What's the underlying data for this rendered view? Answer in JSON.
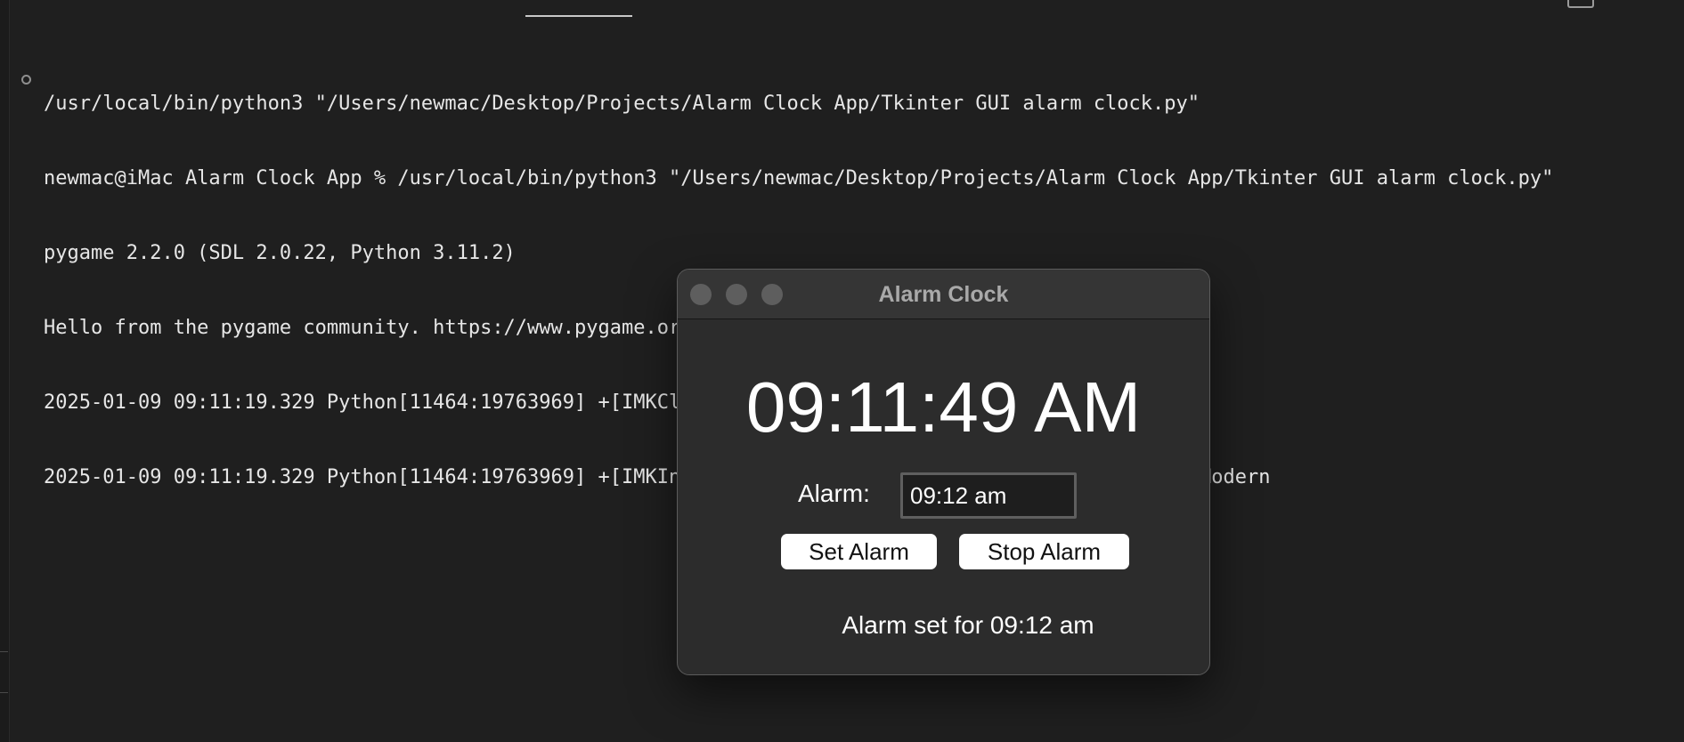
{
  "terminal": {
    "lines": [
      "/usr/local/bin/python3 \"/Users/newmac/Desktop/Projects/Alarm Clock App/Tkinter GUI alarm clock.py\"",
      "newmac@iMac Alarm Clock App % /usr/local/bin/python3 \"/Users/newmac/Desktop/Projects/Alarm Clock App/Tkinter GUI alarm clock.py\"",
      "pygame 2.2.0 (SDL 2.0.22, Python 3.11.2)",
      "Hello from the pygame community. https://www.pygame.org/contribute.html",
      "2025-01-09 09:11:19.329 Python[11464:19763969] +[IMKClient subclass]: chose IMKClient_Modern",
      "2025-01-09 09:11:19.329 Python[11464:19763969] +[IMKInputSession subclass]: chose IMKInputSession_Modern"
    ]
  },
  "alarm_window": {
    "title": "Alarm Clock",
    "current_time": "09:11:49 AM",
    "alarm_label": "Alarm:",
    "alarm_input_value": "09:12 am",
    "set_button": "Set Alarm",
    "stop_button": "Stop Alarm",
    "status": "Alarm set for 09:12 am"
  }
}
